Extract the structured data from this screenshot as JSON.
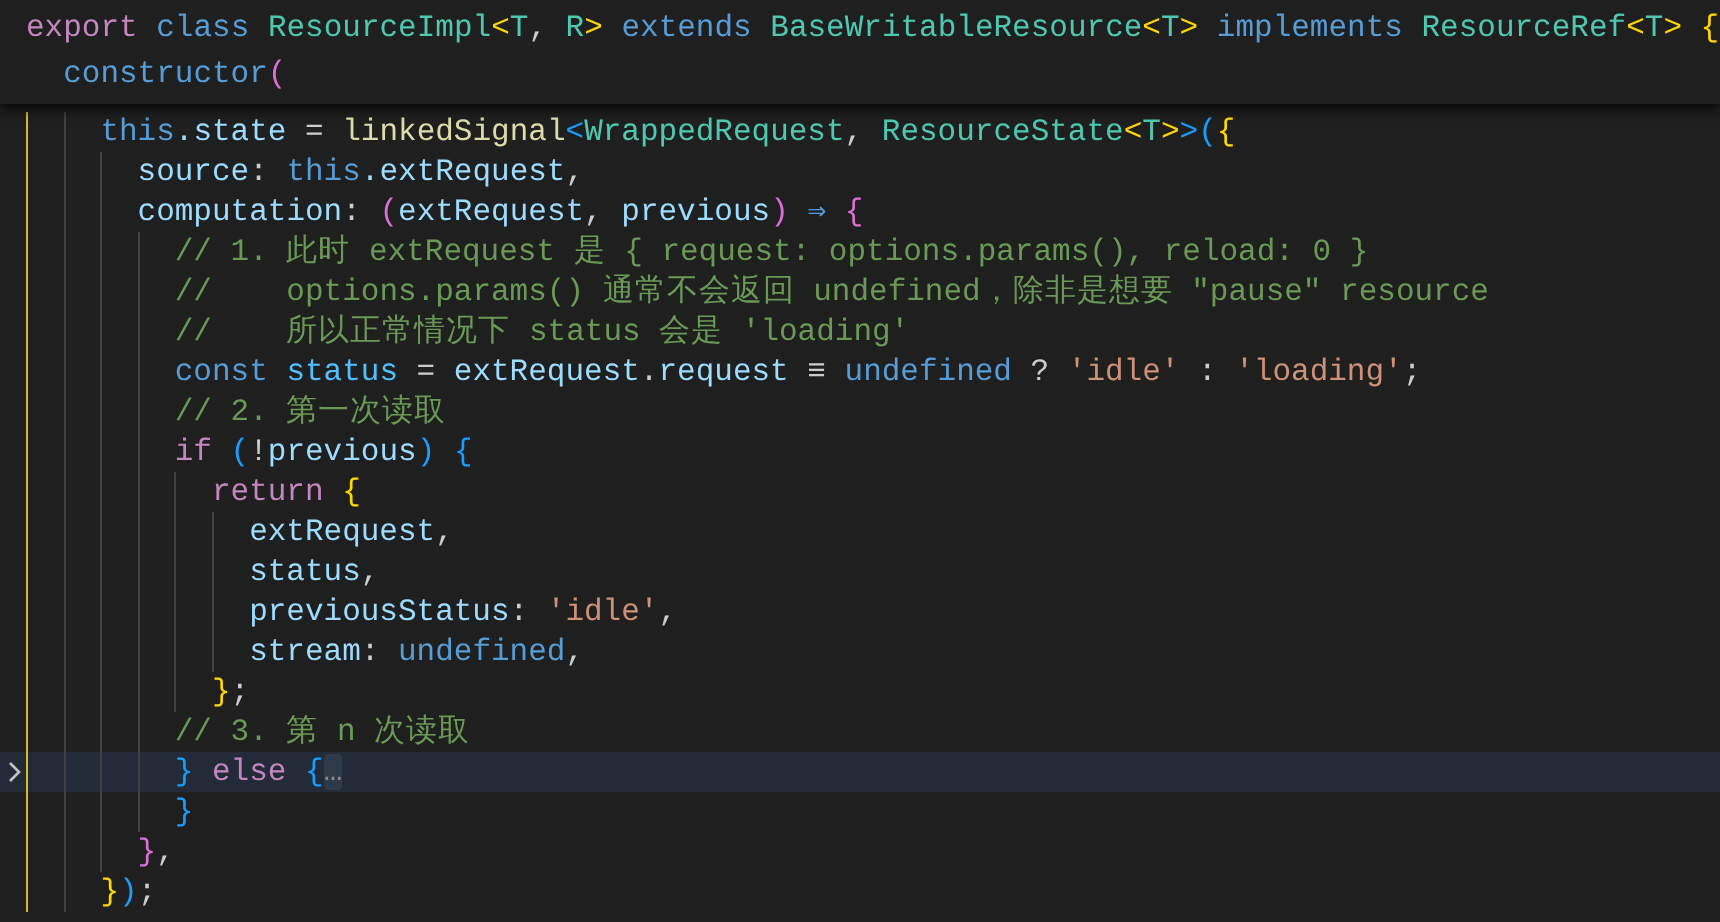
{
  "sticky_header": {
    "lines": [
      {
        "tokens": [
          {
            "kind": "keyword",
            "text": "export "
          },
          {
            "kind": "storage",
            "text": "class "
          },
          {
            "kind": "type",
            "text": "ResourceImpl"
          },
          {
            "kind": "bracket1",
            "text": "<"
          },
          {
            "kind": "type",
            "text": "T"
          },
          {
            "kind": "plain",
            "text": ", "
          },
          {
            "kind": "type",
            "text": "R"
          },
          {
            "kind": "bracket1",
            "text": ">"
          },
          {
            "kind": "storage",
            "text": " extends "
          },
          {
            "kind": "type",
            "text": "BaseWritableResource"
          },
          {
            "kind": "bracket1",
            "text": "<"
          },
          {
            "kind": "type",
            "text": "T"
          },
          {
            "kind": "bracket1",
            "text": ">"
          },
          {
            "kind": "storage",
            "text": " implements "
          },
          {
            "kind": "type",
            "text": "ResourceRef"
          },
          {
            "kind": "bracket1",
            "text": "<"
          },
          {
            "kind": "type",
            "text": "T"
          },
          {
            "kind": "bracket1",
            "text": "> {"
          }
        ]
      },
      {
        "tokens": [
          {
            "kind": "storage",
            "text": "  constructor"
          },
          {
            "kind": "bracket2",
            "text": "("
          }
        ]
      }
    ]
  },
  "editor": {
    "lines": [
      {
        "current": false,
        "folded": false,
        "tokens": [
          {
            "kind": "storage",
            "text": "    this"
          },
          {
            "kind": "variable",
            "text": ".state"
          },
          {
            "kind": "plain",
            "text": " = "
          },
          {
            "kind": "function",
            "text": "linkedSignal"
          },
          {
            "kind": "bracket3",
            "text": "<"
          },
          {
            "kind": "type",
            "text": "WrappedRequest"
          },
          {
            "kind": "plain",
            "text": ", "
          },
          {
            "kind": "type",
            "text": "ResourceState"
          },
          {
            "kind": "bracket1",
            "text": "<"
          },
          {
            "kind": "type",
            "text": "T"
          },
          {
            "kind": "bracket1",
            "text": ">"
          },
          {
            "kind": "bracket3",
            "text": ">("
          },
          {
            "kind": "bracket1",
            "text": "{"
          }
        ]
      },
      {
        "current": false,
        "folded": false,
        "tokens": [
          {
            "kind": "variable",
            "text": "      source"
          },
          {
            "kind": "plain",
            "text": ": "
          },
          {
            "kind": "storage",
            "text": "this"
          },
          {
            "kind": "variable",
            "text": ".extRequest"
          },
          {
            "kind": "plain",
            "text": ","
          }
        ]
      },
      {
        "current": false,
        "folded": false,
        "tokens": [
          {
            "kind": "variable",
            "text": "      computation"
          },
          {
            "kind": "plain",
            "text": ": "
          },
          {
            "kind": "bracket2",
            "text": "("
          },
          {
            "kind": "variable",
            "text": "extRequest"
          },
          {
            "kind": "plain",
            "text": ", "
          },
          {
            "kind": "variable",
            "text": "previous"
          },
          {
            "kind": "bracket2",
            "text": ")"
          },
          {
            "kind": "storage",
            "text": " ⇒ "
          },
          {
            "kind": "bracket2",
            "text": "{"
          }
        ]
      },
      {
        "current": false,
        "folded": false,
        "tokens": [
          {
            "kind": "comment",
            "text": "        // 1. 此时 extRequest 是 { request: options.params(), reload: 0 }"
          }
        ]
      },
      {
        "current": false,
        "folded": false,
        "tokens": [
          {
            "kind": "comment",
            "text": "        //    options.params() 通常不会返回 undefined，除非是想要 \"pause\" resource"
          }
        ]
      },
      {
        "current": false,
        "folded": false,
        "tokens": [
          {
            "kind": "comment",
            "text": "        //    所以正常情况下 status 会是 'loading'"
          }
        ]
      },
      {
        "current": false,
        "folded": false,
        "tokens": [
          {
            "kind": "storage",
            "text": "        const "
          },
          {
            "kind": "constant",
            "text": "status"
          },
          {
            "kind": "plain",
            "text": " = "
          },
          {
            "kind": "variable",
            "text": "extRequest"
          },
          {
            "kind": "plain",
            "text": "."
          },
          {
            "kind": "variable",
            "text": "request"
          },
          {
            "kind": "plain",
            "text": " ≡ "
          },
          {
            "kind": "storage",
            "text": "undefined"
          },
          {
            "kind": "plain",
            "text": " ? "
          },
          {
            "kind": "string",
            "text": "'idle'"
          },
          {
            "kind": "plain",
            "text": " : "
          },
          {
            "kind": "string",
            "text": "'loading'"
          },
          {
            "kind": "plain",
            "text": ";"
          }
        ]
      },
      {
        "current": false,
        "folded": false,
        "tokens": [
          {
            "kind": "comment",
            "text": "        // 2. 第一次读取"
          }
        ]
      },
      {
        "current": false,
        "folded": false,
        "tokens": [
          {
            "kind": "keyword",
            "text": "        if "
          },
          {
            "kind": "bracket3",
            "text": "("
          },
          {
            "kind": "plain",
            "text": "!"
          },
          {
            "kind": "variable",
            "text": "previous"
          },
          {
            "kind": "bracket3",
            "text": ")"
          },
          {
            "kind": "bracket3",
            "text": " {"
          }
        ]
      },
      {
        "current": false,
        "folded": false,
        "tokens": [
          {
            "kind": "keyword",
            "text": "          return "
          },
          {
            "kind": "bracket1",
            "text": "{"
          }
        ]
      },
      {
        "current": false,
        "folded": false,
        "tokens": [
          {
            "kind": "variable",
            "text": "            extRequest"
          },
          {
            "kind": "plain",
            "text": ","
          }
        ]
      },
      {
        "current": false,
        "folded": false,
        "tokens": [
          {
            "kind": "variable",
            "text": "            status"
          },
          {
            "kind": "plain",
            "text": ","
          }
        ]
      },
      {
        "current": false,
        "folded": false,
        "tokens": [
          {
            "kind": "variable",
            "text": "            previousStatus"
          },
          {
            "kind": "plain",
            "text": ": "
          },
          {
            "kind": "string",
            "text": "'idle'"
          },
          {
            "kind": "plain",
            "text": ","
          }
        ]
      },
      {
        "current": false,
        "folded": false,
        "tokens": [
          {
            "kind": "variable",
            "text": "            stream"
          },
          {
            "kind": "plain",
            "text": ": "
          },
          {
            "kind": "storage",
            "text": "undefined"
          },
          {
            "kind": "plain",
            "text": ","
          }
        ]
      },
      {
        "current": false,
        "folded": false,
        "tokens": [
          {
            "kind": "bracket1",
            "text": "          }"
          },
          {
            "kind": "plain",
            "text": ";"
          }
        ]
      },
      {
        "current": false,
        "folded": false,
        "tokens": [
          {
            "kind": "comment",
            "text": "        // 3. 第 n 次读取"
          }
        ]
      },
      {
        "current": true,
        "folded": true,
        "tokens": [
          {
            "kind": "bracket3",
            "text": "        }"
          },
          {
            "kind": "keyword",
            "text": " else "
          },
          {
            "kind": "bracket3",
            "text": "{"
          },
          {
            "kind": "fold",
            "text": "…"
          }
        ]
      },
      {
        "current": false,
        "folded": false,
        "tokens": [
          {
            "kind": "bracket3",
            "text": "        }"
          }
        ]
      },
      {
        "current": false,
        "folded": false,
        "tokens": [
          {
            "kind": "bracket2",
            "text": "      }"
          },
          {
            "kind": "plain",
            "text": ","
          }
        ]
      },
      {
        "current": false,
        "folded": false,
        "tokens": [
          {
            "kind": "bracket1",
            "text": "    }"
          },
          {
            "kind": "bracket3",
            "text": ")"
          },
          {
            "kind": "plain",
            "text": ";"
          }
        ]
      }
    ]
  }
}
